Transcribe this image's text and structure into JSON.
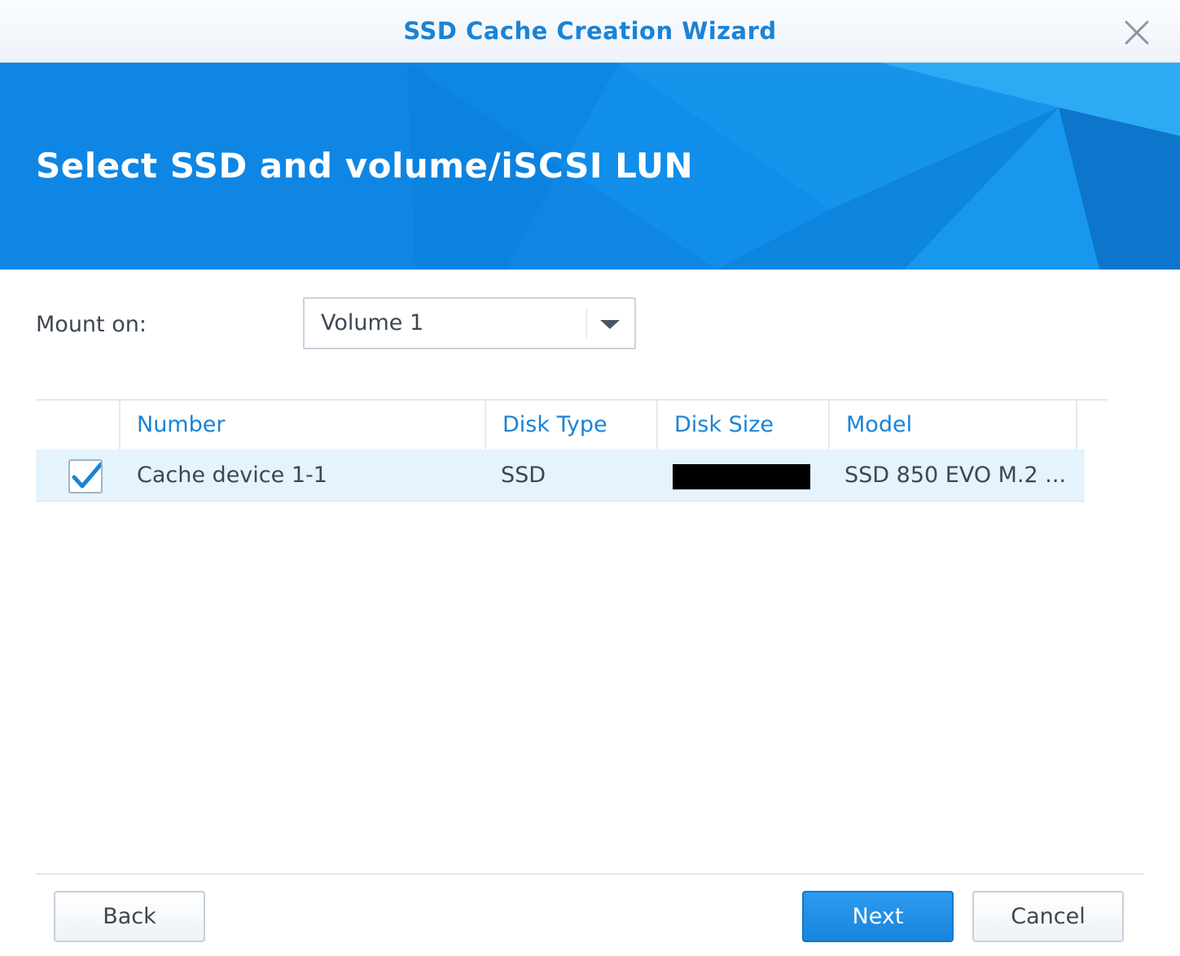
{
  "window": {
    "title": "SSD Cache Creation Wizard"
  },
  "banner": {
    "heading": "Select SSD and volume/iSCSI LUN"
  },
  "mount": {
    "label": "Mount on:",
    "selected": "Volume 1"
  },
  "table": {
    "columns": [
      "Number",
      "Disk Type",
      "Disk Size",
      "Model"
    ],
    "rows": [
      {
        "checked": true,
        "number": "Cache device 1-1",
        "disk_type": "SSD",
        "disk_size": "",
        "model": "SSD 850 EVO M.2 ..."
      }
    ]
  },
  "footer": {
    "back_label": "Back",
    "next_label": "Next",
    "cancel_label": "Cancel"
  },
  "colors": {
    "accent": "#1a83d6",
    "banner": "#0f86e3",
    "selected_row": "#e5f3fd",
    "text": "#3d4754"
  }
}
